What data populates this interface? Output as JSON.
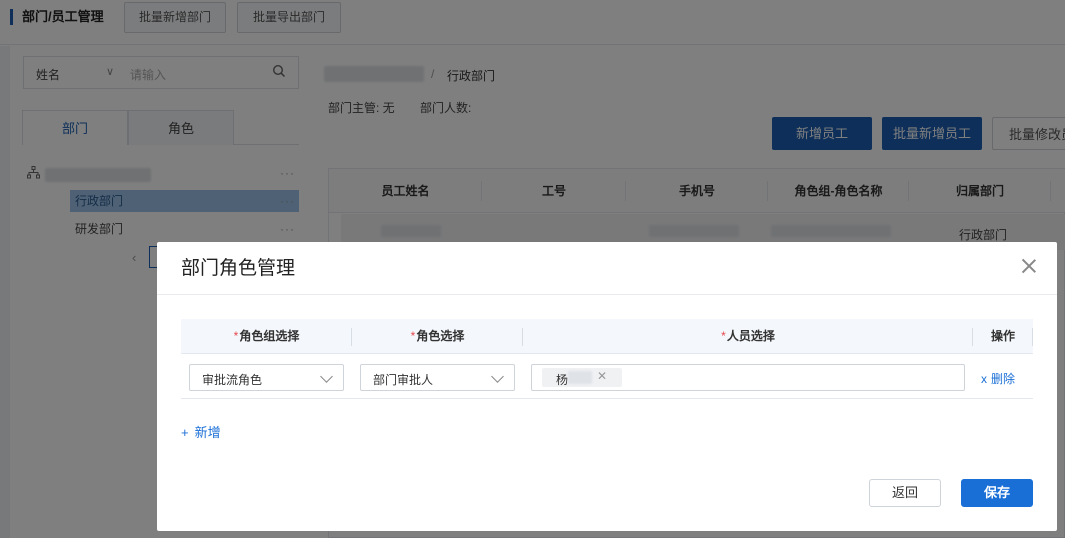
{
  "header": {
    "title": "部门/员工管理",
    "batch_add_dept": "批量新增部门",
    "batch_export_dept": "批量导出部门"
  },
  "left": {
    "search": {
      "field": "姓名",
      "placeholder": "请输入"
    },
    "tabs": [
      "部门",
      "角色"
    ],
    "tree": {
      "items": [
        "行政部门",
        "研发部门"
      ],
      "more": "···"
    }
  },
  "right": {
    "breadcrumb": {
      "separator": "/",
      "current": "行政部门"
    },
    "info": {
      "manager": "部门主管: 无",
      "count": "部门人数:"
    },
    "buttons": {
      "add_employee": "新增员工",
      "batch_add_employee": "批量新增员工",
      "batch_modify": "批量修改员"
    },
    "table": {
      "columns": [
        "员工姓名",
        "工号",
        "手机号",
        "角色组-角色名称",
        "归属部门"
      ],
      "row_dept": "行政部门"
    }
  },
  "modal": {
    "title": "部门角色管理",
    "columns": [
      {
        "required": "*",
        "label": "角色组选择"
      },
      {
        "required": "*",
        "label": "角色选择"
      },
      {
        "required": "*",
        "label": "人员选择"
      },
      {
        "required": "",
        "label": "操作"
      }
    ],
    "row": {
      "role_group": "审批流角色",
      "role": "部门审批人",
      "person_tag": "杨",
      "delete_x": "x",
      "delete": "删除"
    },
    "add_new": "新增",
    "back": "返回",
    "save": "保存"
  }
}
